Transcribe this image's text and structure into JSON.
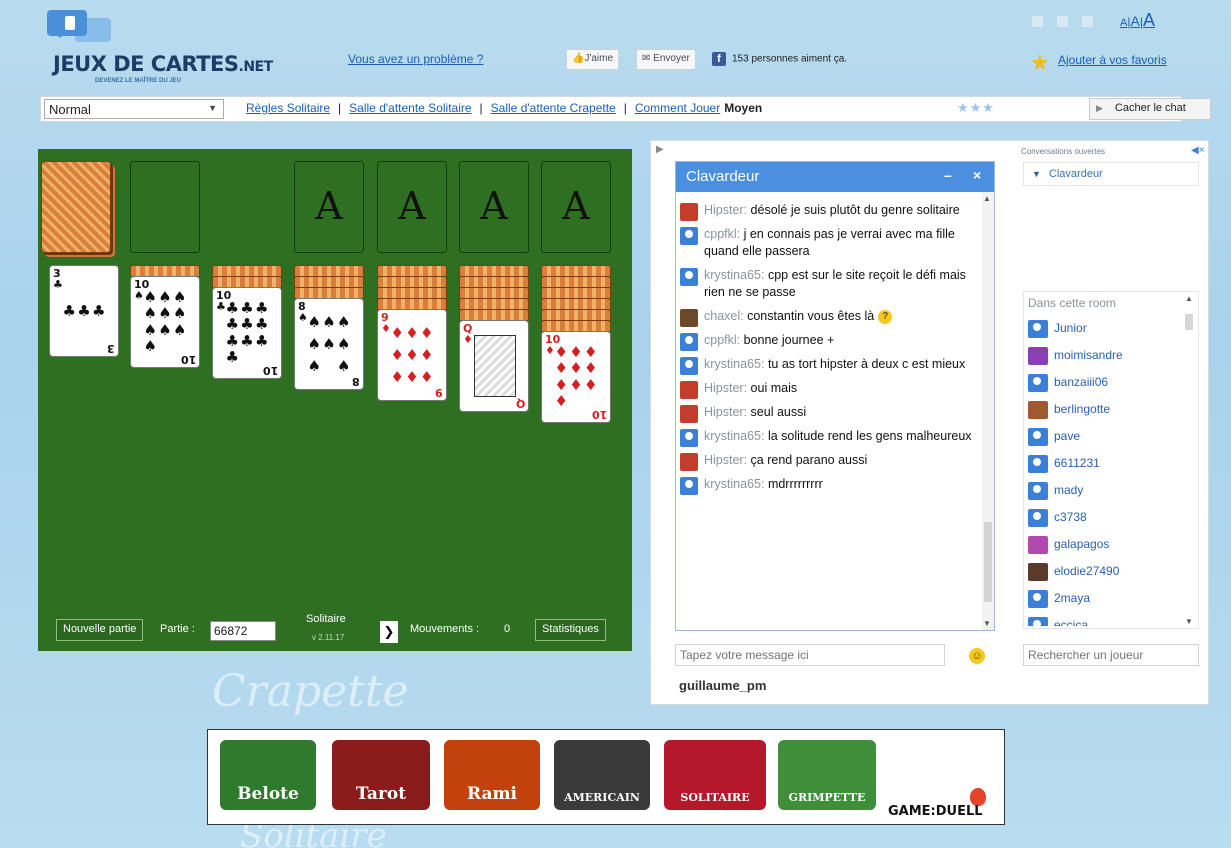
{
  "header": {
    "logo_title": "JEUX DE CARTES",
    "logo_suffix": ".NET",
    "logo_tagline": "DEVENEZ LE MAÎTRE DU JEU",
    "problem_link": "Vous avez un problème ?",
    "fb_like": "J'aime",
    "fb_send": "Envoyer",
    "fb_count_text": "153 personnes aiment ça.",
    "favorites_link": "Ajouter à vos favoris",
    "font_size_small": "A",
    "font_size_medium": "A",
    "font_size_large": "A",
    "separator": "|"
  },
  "navbar": {
    "level_value": "Normal",
    "links": [
      "Règles Solitaire",
      "Salle d'attente Solitaire",
      "Salle d'attente Crapette",
      "Comment Jouer"
    ],
    "separator": "|",
    "level_label": "Moyen",
    "difficulty_stars": 3,
    "hide_chat": "Cacher le chat"
  },
  "game": {
    "foundation_label": "A",
    "tableau_cards": [
      {
        "rank": "3",
        "suit": "♣",
        "color": "black"
      },
      {
        "rank": "10",
        "suit": "♠",
        "color": "black"
      },
      {
        "rank": "10",
        "suit": "♣",
        "color": "black"
      },
      {
        "rank": "8",
        "suit": "♠",
        "color": "black"
      },
      {
        "rank": "9",
        "suit": "♦",
        "color": "red"
      },
      {
        "rank": "Q",
        "suit": "♦",
        "color": "red"
      },
      {
        "rank": "10",
        "suit": "♦",
        "color": "red"
      }
    ],
    "hidden_counts": [
      0,
      1,
      2,
      3,
      4,
      5,
      6
    ],
    "new_game_button": "Nouvelle partie",
    "game_number_label": "Partie :",
    "game_number": "66872",
    "title": "Solitaire",
    "version": "v 2.11.17",
    "next_button": "❯",
    "moves_label": "Mouvements :",
    "moves": "0",
    "stats_button": "Statistiques"
  },
  "chat": {
    "title": "Clavardeur",
    "minimize": "–",
    "close": "×",
    "messages": [
      {
        "nick": "Hipster",
        "text": "désolé je suis plutôt du genre solitaire",
        "avatar": "red"
      },
      {
        "nick": "cppfkl",
        "text": "j en connais pas je verrai avec ma fille quand elle passera",
        "avatar": "blue"
      },
      {
        "nick": "krystina65",
        "text": "cpp est sur le site reçoit le défi mais rien ne se passe",
        "avatar": "blue"
      },
      {
        "nick": "chaxel",
        "text": "constantin vous êtes là",
        "avatar": "photo",
        "emoji": "?"
      },
      {
        "nick": "cppfkl",
        "text": "bonne journee +",
        "avatar": "blue"
      },
      {
        "nick": "krystina65",
        "text": "tu as tort hipster à deux c est mieux",
        "avatar": "blue"
      },
      {
        "nick": "Hipster",
        "text": "oui mais",
        "avatar": "red"
      },
      {
        "nick": "Hipster",
        "text": "seul aussi",
        "avatar": "red"
      },
      {
        "nick": "krystina65",
        "text": "la solitude rend les gens malheureux",
        "avatar": "blue"
      },
      {
        "nick": "Hipster",
        "text": "ça rend parano aussi",
        "avatar": "red"
      },
      {
        "nick": "krystina65",
        "text": "mdrrrrrrrrr",
        "avatar": "blue"
      }
    ],
    "input_placeholder": "Tapez votre message ici",
    "current_user": "guillaume_pm",
    "open_conversations_label": "Conversations ouvertes",
    "open_conversation": "Clavardeur",
    "room_title": "Dans cette room",
    "room_users": [
      {
        "name": "Junior",
        "avatar": "blue"
      },
      {
        "name": "moimisandre",
        "avatar": "photo"
      },
      {
        "name": "banzaiii06",
        "avatar": "blue"
      },
      {
        "name": "berlingotte",
        "avatar": "photo"
      },
      {
        "name": "pave",
        "avatar": "blue"
      },
      {
        "name": "6611231",
        "avatar": "blue"
      },
      {
        "name": "mady",
        "avatar": "blue"
      },
      {
        "name": "c3738",
        "avatar": "blue"
      },
      {
        "name": "galapagos",
        "avatar": "photo"
      },
      {
        "name": "elodie27490",
        "avatar": "photo"
      },
      {
        "name": "2maya",
        "avatar": "blue"
      },
      {
        "name": "eccica",
        "avatar": "blue"
      }
    ],
    "search_placeholder": "Rechercher un joueur"
  },
  "watermarks": {
    "crapette": "Crapette",
    "solitaire": "Solitaire"
  },
  "banner": {
    "games": [
      {
        "name": "Belote",
        "color": "#2f7a2c"
      },
      {
        "name": "Tarot",
        "color": "#8a1c1c"
      },
      {
        "name": "Rami",
        "color": "#c2410c"
      },
      {
        "name": "AMERICAIN",
        "color": "#3a3a3a"
      },
      {
        "name": "SOLITAIRE",
        "color": "#b3182b"
      },
      {
        "name": "GRIMPETTE",
        "color": "#3f8f3a"
      }
    ],
    "brand": "GAME:DUELL"
  },
  "colors": {
    "board_green": "#2e6f22",
    "link_blue": "#1a5fb4",
    "chat_title_blue": "#4a8fe0"
  }
}
